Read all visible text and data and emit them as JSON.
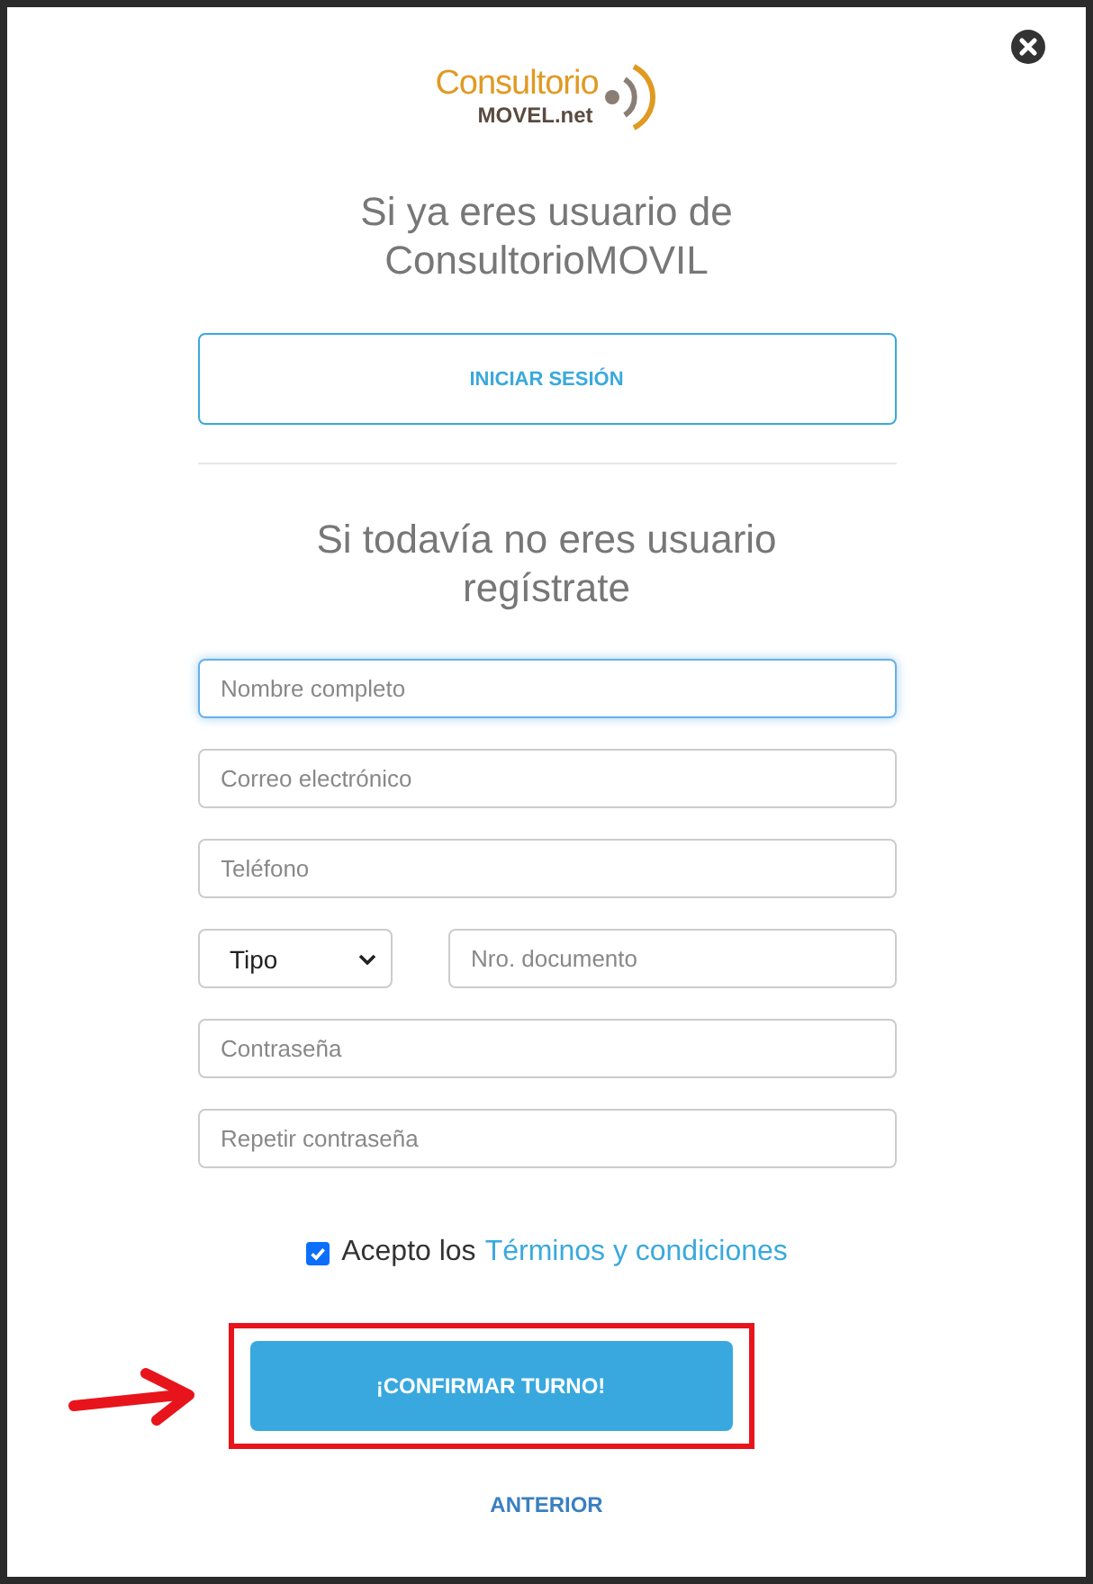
{
  "logo": {
    "top": "Consultorio",
    "bottom": "MOVEL.net"
  },
  "login": {
    "title": "Si ya eres usuario de ConsultorioMOVIL",
    "button": "INICIAR SESIÓN"
  },
  "register": {
    "title": "Si todavía no eres usuario regístrate",
    "rows": [
      [
        {
          "kind": "input",
          "placeholder": "Nombre completo",
          "focused": true
        }
      ],
      [
        {
          "kind": "input",
          "placeholder": "Correo electrónico",
          "focused": false
        }
      ],
      [
        {
          "kind": "input",
          "placeholder": "Teléfono",
          "focused": false
        }
      ],
      [
        {
          "kind": "select",
          "value": "Tipo",
          "focused": false
        },
        {
          "kind": "input",
          "placeholder": "Nro. documento",
          "focused": false
        }
      ],
      [
        {
          "kind": "input",
          "placeholder": "Contraseña",
          "focused": false
        }
      ],
      [
        {
          "kind": "input",
          "placeholder": "Repetir contraseña",
          "focused": false
        }
      ]
    ],
    "terms": {
      "checked": true,
      "text": "Acepto los",
      "link": "Términos y condiciones"
    },
    "confirm": {
      "label": "¡CONFIRMAR TURNO!",
      "highlighted": true
    },
    "back": "ANTERIOR"
  }
}
